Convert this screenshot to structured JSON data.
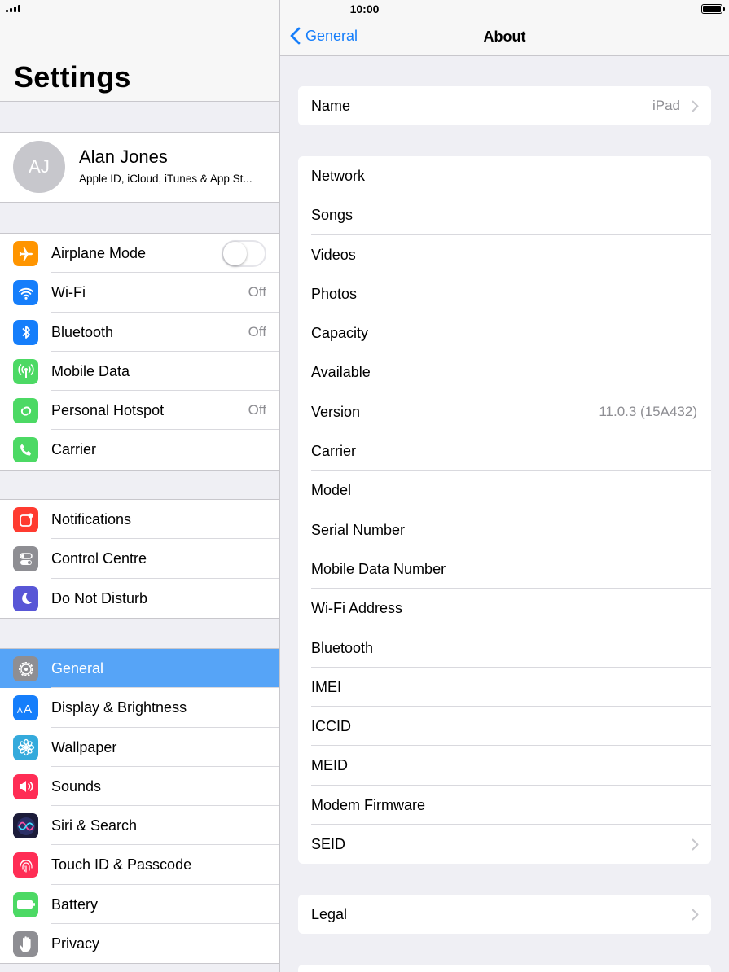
{
  "status_bar": {
    "time": "10:00"
  },
  "sidebar": {
    "title": "Settings",
    "profile": {
      "initials": "AJ",
      "name": "Alan Jones",
      "subtitle": "Apple ID, iCloud, iTunes & App St..."
    },
    "groups": [
      [
        {
          "label": "Airplane Mode",
          "icon": "airplane-icon",
          "color": "#ff9500",
          "toggle": "off"
        },
        {
          "label": "Wi-Fi",
          "icon": "wifi-icon",
          "color": "#157efb",
          "value": "Off"
        },
        {
          "label": "Bluetooth",
          "icon": "bluetooth-icon",
          "color": "#157efb",
          "value": "Off"
        },
        {
          "label": "Mobile Data",
          "icon": "antenna-icon",
          "color": "#4cd964"
        },
        {
          "label": "Personal Hotspot",
          "icon": "hotspot-icon",
          "color": "#4cd964",
          "value": "Off"
        },
        {
          "label": "Carrier",
          "icon": "phone-icon",
          "color": "#4cd964"
        }
      ],
      [
        {
          "label": "Notifications",
          "icon": "notifications-icon",
          "color": "#ff3b30"
        },
        {
          "label": "Control Centre",
          "icon": "switches-icon",
          "color": "#8e8e93"
        },
        {
          "label": "Do Not Disturb",
          "icon": "moon-icon",
          "color": "#5856d6"
        }
      ],
      [
        {
          "label": "General",
          "icon": "gear-icon",
          "color": "#8e8e93",
          "selected": true
        },
        {
          "label": "Display & Brightness",
          "icon": "text-size-icon",
          "color": "#157efb"
        },
        {
          "label": "Wallpaper",
          "icon": "flower-icon",
          "color": "#34aadc"
        },
        {
          "label": "Sounds",
          "icon": "speaker-icon",
          "color": "#ff2d55"
        },
        {
          "label": "Siri & Search",
          "icon": "siri-icon",
          "color": "#1c1c3a"
        },
        {
          "label": "Touch ID & Passcode",
          "icon": "fingerprint-icon",
          "color": "#ff2d55"
        },
        {
          "label": "Battery",
          "icon": "battery-icon",
          "color": "#4cd964"
        },
        {
          "label": "Privacy",
          "icon": "hand-icon",
          "color": "#8e8e93"
        }
      ]
    ]
  },
  "detail": {
    "back_label": "General",
    "title": "About",
    "sections": [
      [
        {
          "label": "Name",
          "value": "iPad",
          "chevron": true
        }
      ],
      [
        {
          "label": "Network"
        },
        {
          "label": "Songs"
        },
        {
          "label": "Videos"
        },
        {
          "label": "Photos"
        },
        {
          "label": "Capacity"
        },
        {
          "label": "Available"
        },
        {
          "label": "Version",
          "value": "11.0.3 (15A432)"
        },
        {
          "label": "Carrier"
        },
        {
          "label": "Model"
        },
        {
          "label": "Serial Number"
        },
        {
          "label": "Mobile Data Number"
        },
        {
          "label": "Wi-Fi Address"
        },
        {
          "label": "Bluetooth"
        },
        {
          "label": "IMEI"
        },
        {
          "label": "ICCID"
        },
        {
          "label": "MEID"
        },
        {
          "label": "Modem Firmware"
        },
        {
          "label": "SEID",
          "chevron": true
        }
      ],
      [
        {
          "label": "Legal",
          "chevron": true
        }
      ]
    ]
  }
}
